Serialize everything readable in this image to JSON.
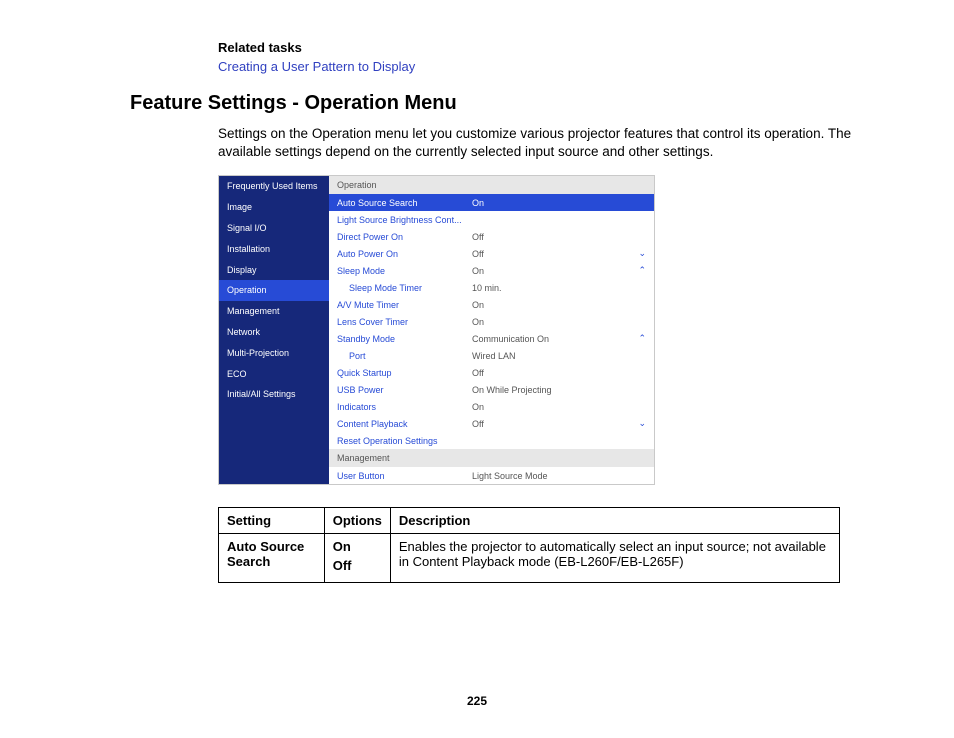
{
  "related_tasks": {
    "heading": "Related tasks",
    "link": "Creating a User Pattern to Display"
  },
  "section_title": "Feature Settings - Operation Menu",
  "intro": "Settings on the Operation menu let you customize various projector features that control its operation. The available settings depend on the currently selected input source and other settings.",
  "menu": {
    "sidebar": [
      "Frequently Used Items",
      "Image",
      "Signal I/O",
      "Installation",
      "Display",
      "Operation",
      "Management",
      "Network",
      "Multi-Projection",
      "ECO",
      "Initial/All Settings"
    ],
    "sidebar_selected": "Operation",
    "sections": [
      {
        "header": "Operation",
        "rows": [
          {
            "label": "Auto Source Search",
            "value": "On",
            "selected": true
          },
          {
            "label": "Light Source Brightness Cont...",
            "value": ""
          },
          {
            "label": "Direct Power On",
            "value": "Off"
          },
          {
            "label": "Auto Power On",
            "value": "Off",
            "chev": "⌄"
          },
          {
            "label": "Sleep Mode",
            "value": "On",
            "chev": "⌃"
          },
          {
            "label": "Sleep Mode Timer",
            "value": "10 min.",
            "sub": true
          },
          {
            "label": "A/V Mute Timer",
            "value": "On"
          },
          {
            "label": "Lens Cover Timer",
            "value": "On"
          },
          {
            "label": "Standby Mode",
            "value": "Communication On",
            "chev": "⌃"
          },
          {
            "label": "Port",
            "value": "Wired LAN",
            "sub": true
          },
          {
            "label": "Quick Startup",
            "value": "Off"
          },
          {
            "label": "USB Power",
            "value": "On While Projecting"
          },
          {
            "label": "Indicators",
            "value": "On"
          },
          {
            "label": "Content Playback",
            "value": "Off",
            "chev": "⌄"
          },
          {
            "label": "Reset Operation Settings",
            "value": ""
          }
        ]
      },
      {
        "header": "Management",
        "rows": [
          {
            "label": "User Button",
            "value": "Light Source Mode"
          }
        ]
      }
    ]
  },
  "table": {
    "headers": [
      "Setting",
      "Options",
      "Description"
    ],
    "rows": [
      {
        "setting": "Auto Source Search",
        "options": [
          "On",
          "Off"
        ],
        "description": "Enables the projector to automatically select an input source; not available in Content Playback mode (EB-L260F/EB-L265F)"
      }
    ]
  },
  "page_number": "225"
}
